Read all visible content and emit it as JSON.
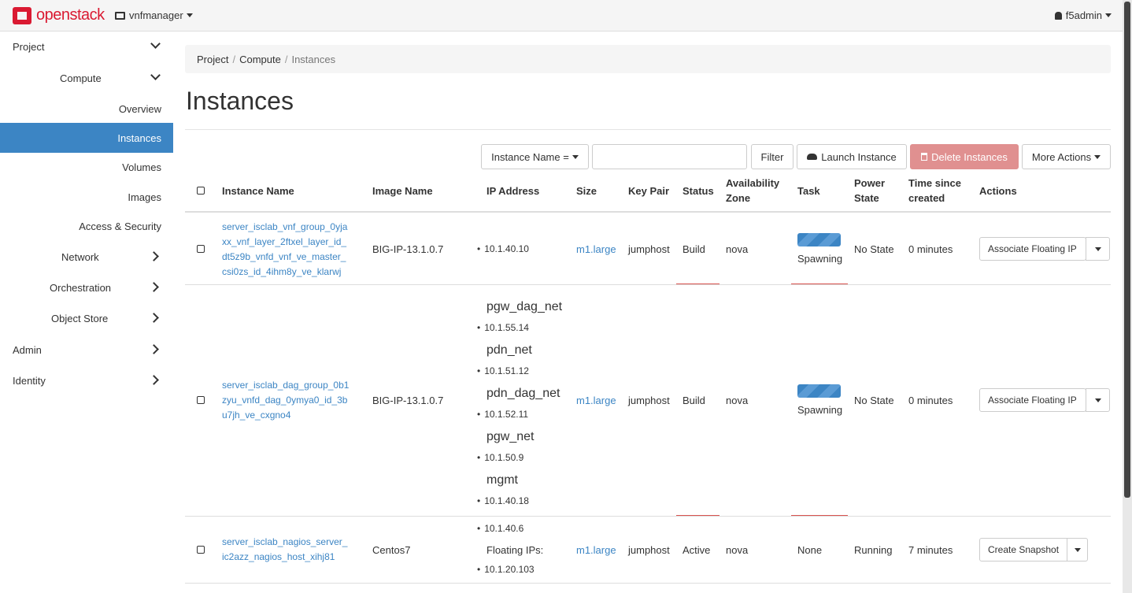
{
  "navbar": {
    "brand": "openstack",
    "project": "vnfmanager",
    "user": "f5admin"
  },
  "sidebar": {
    "project": "Project",
    "compute": "Compute",
    "overview": "Overview",
    "instances": "Instances",
    "volumes": "Volumes",
    "images": "Images",
    "access_security": "Access & Security",
    "network": "Network",
    "orchestration": "Orchestration",
    "object_store": "Object Store",
    "admin": "Admin",
    "identity": "Identity"
  },
  "breadcrumb": [
    "Project",
    "Compute",
    "Instances"
  ],
  "page_title": "Instances",
  "toolbar": {
    "filter_select": "Instance Name =",
    "filter_input_value": "",
    "filter_button": "Filter",
    "launch_button": "Launch Instance",
    "delete_button": "Delete Instances",
    "more_actions": "More Actions"
  },
  "table": {
    "headers": {
      "name": "Instance Name",
      "image": "Image Name",
      "ip": "IP Address",
      "size": "Size",
      "keypair": "Key Pair",
      "status": "Status",
      "zone_1": "Availability",
      "zone_2": "Zone",
      "task": "Task",
      "power_1": "Power",
      "power_2": "State",
      "time_1": "Time since",
      "time_2": "created",
      "actions": "Actions"
    },
    "rows": [
      {
        "name_lines": [
          "server_isclab_vnf_group_0yja",
          "xx_vnf_layer_2ftxel_layer_id_",
          "dt5z9b_vnfd_vnf_ve_master_",
          "csi0zs_id_4ihm8y_ve_klarwj"
        ],
        "image": "BIG-IP-13.1.0.7",
        "ip": "10.1.40.10",
        "size": "m1.large",
        "keypair": "jumphost",
        "status": "Build",
        "zone": "nova",
        "task": "Spawning",
        "power": "No State",
        "time": "0 minutes",
        "action": "Associate Floating IP"
      },
      {
        "name_lines": [
          "server_isclab_dag_group_0b1",
          "zyu_vnfd_dag_0ymya0_id_3b",
          "u7jh_ve_cxgno4"
        ],
        "image": "BIG-IP-13.1.0.7",
        "networks": [
          {
            "net": "pgw_dag_net",
            "ip": "10.1.55.14"
          },
          {
            "net": "pdn_net",
            "ip": "10.1.51.12"
          },
          {
            "net": "pdn_dag_net",
            "ip": "10.1.52.11"
          },
          {
            "net": "pgw_net",
            "ip": "10.1.50.9"
          },
          {
            "net": "mgmt",
            "ip": "10.1.40.18"
          }
        ],
        "size": "m1.large",
        "keypair": "jumphost",
        "status": "Build",
        "zone": "nova",
        "task": "Spawning",
        "power": "No State",
        "time": "0 minutes",
        "action": "Associate Floating IP"
      },
      {
        "name_lines": [
          "server_isclab_nagios_server_",
          "ic2azz_nagios_host_xihj81"
        ],
        "image": "Centos7",
        "ip": "10.1.40.6",
        "floating_label": "Floating IPs:",
        "floating_ip": "10.1.20.103",
        "size": "m1.large",
        "keypair": "jumphost",
        "status": "Active",
        "zone": "nova",
        "task": "None",
        "power": "Running",
        "time": "7 minutes",
        "action": "Create Snapshot"
      }
    ]
  }
}
